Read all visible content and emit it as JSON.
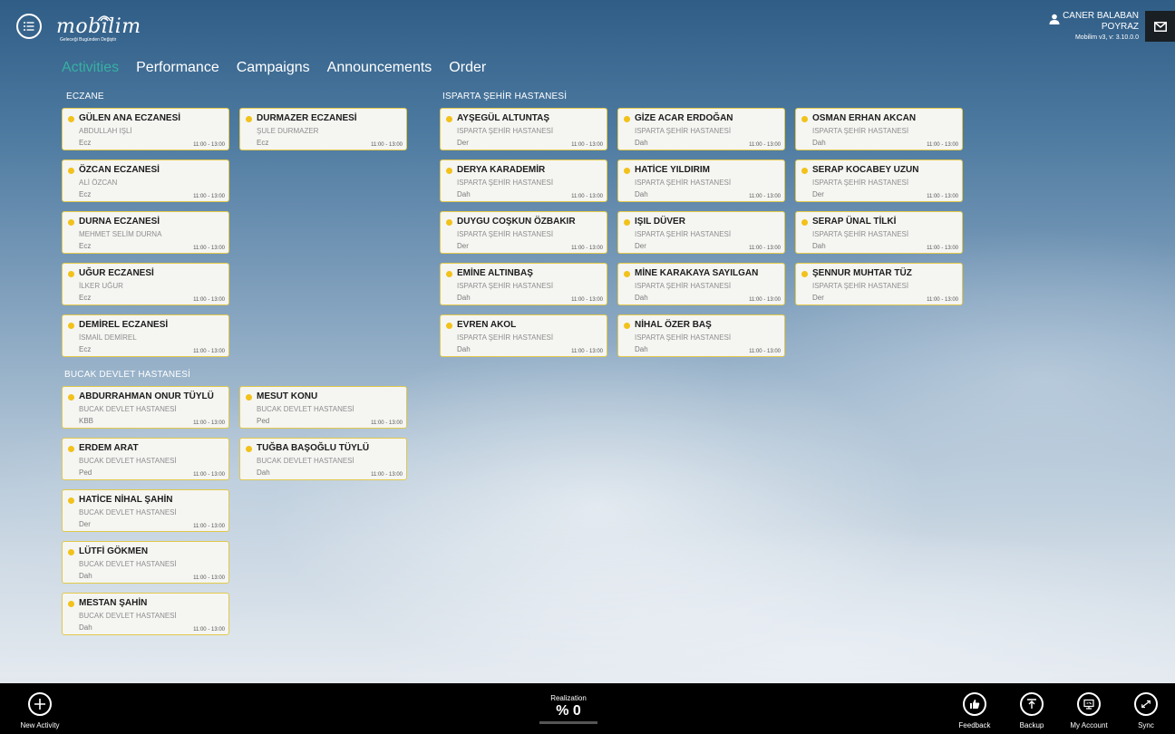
{
  "app": {
    "logo": "mobilim",
    "logo_tagline": "Geleceği Bugünden Değiştir",
    "menu_icon": "hamburger-menu-icon"
  },
  "user": {
    "name": "CANER BALABAN",
    "company": "POYRAZ",
    "version": "Mobilim v3, v: 3.10.0.0",
    "icon": "user-icon"
  },
  "nav": {
    "tabs": [
      {
        "label": "Activities",
        "active": true
      },
      {
        "label": "Performance",
        "active": false
      },
      {
        "label": "Campaigns",
        "active": false
      },
      {
        "label": "Announcements",
        "active": false
      },
      {
        "label": "Order",
        "active": false
      }
    ]
  },
  "groups": {
    "eczane": {
      "title": "ECZANE",
      "cards": [
        {
          "name": "GÜLEN ANA ECZANESİ",
          "sub": "ABDULLAH IŞLİ",
          "spec": "Ecz",
          "time": "11:00 - 13:00"
        },
        {
          "name": "DURMAZER ECZANESİ",
          "sub": "ŞULE DURMAZER",
          "spec": "Ecz",
          "time": "11:00 - 13:00"
        },
        {
          "name": "ÖZCAN ECZANESİ",
          "sub": "ALİ ÖZCAN",
          "spec": "Ecz",
          "time": "11:00 - 13:00"
        },
        {
          "name": "DURNA ECZANESİ",
          "sub": "MEHMET SELİM DURNA",
          "spec": "Ecz",
          "time": "11:00 - 13:00"
        },
        {
          "name": "UĞUR ECZANESİ",
          "sub": "İLKER UĞUR",
          "spec": "Ecz",
          "time": "11:00 - 13:00"
        },
        {
          "name": "DEMİREL ECZANESİ",
          "sub": "İSMAİL DEMİREL",
          "spec": "Ecz",
          "time": "11:00 - 13:00"
        }
      ]
    },
    "bucak": {
      "title": "BUCAK DEVLET HASTANESİ",
      "cards": [
        {
          "name": "ABDURRAHMAN ONUR TÜYLÜ",
          "sub": "BUCAK DEVLET HASTANESİ",
          "spec": "KBB",
          "time": "11:00 - 13:00"
        },
        {
          "name": "MESUT KONU",
          "sub": "BUCAK DEVLET HASTANESİ",
          "spec": "Ped",
          "time": "11:00 - 13:00"
        },
        {
          "name": "ERDEM ARAT",
          "sub": "BUCAK DEVLET HASTANESİ",
          "spec": "Ped",
          "time": "11:00 - 13:00"
        },
        {
          "name": "TUĞBA BAŞOĞLU TÜYLÜ",
          "sub": "BUCAK DEVLET HASTANESİ",
          "spec": "Dah",
          "time": "11:00 - 13:00"
        },
        {
          "name": "HATİCE NİHAL ŞAHİN",
          "sub": "BUCAK DEVLET HASTANESİ",
          "spec": "Der",
          "time": "11:00 - 13:00"
        },
        {
          "name": "LÜTFİ GÖKMEN",
          "sub": "BUCAK DEVLET HASTANESİ",
          "spec": "Dah",
          "time": "11:00 - 13:00"
        },
        {
          "name": "MESTAN ŞAHİN",
          "sub": "BUCAK DEVLET HASTANESİ",
          "spec": "Dah",
          "time": "11:00 - 13:00"
        }
      ]
    },
    "isparta": {
      "title": "ISPARTA ŞEHİR HASTANESİ",
      "cards": [
        {
          "name": "AYŞEGÜL ALTUNTAŞ",
          "sub": "ISPARTA ŞEHİR HASTANESİ",
          "spec": "Der",
          "time": "11:00 - 13:00"
        },
        {
          "name": "GİZE ACAR ERDOĞAN",
          "sub": "ISPARTA ŞEHİR HASTANESİ",
          "spec": "Dah",
          "time": "11:00 - 13:00"
        },
        {
          "name": "OSMAN ERHAN AKCAN",
          "sub": "ISPARTA ŞEHİR HASTANESİ",
          "spec": "Dah",
          "time": "11:00 - 13:00"
        },
        {
          "name": "DERYA KARADEMİR",
          "sub": "ISPARTA ŞEHİR HASTANESİ",
          "spec": "Dah",
          "time": "11:00 - 13:00"
        },
        {
          "name": "HATİCE YILDIRIM",
          "sub": "ISPARTA ŞEHİR HASTANESİ",
          "spec": "Dah",
          "time": "11:00 - 13:00"
        },
        {
          "name": "SERAP KOCABEY UZUN",
          "sub": "ISPARTA ŞEHİR HASTANESİ",
          "spec": "Der",
          "time": "11:00 - 13:00"
        },
        {
          "name": "DUYGU COŞKUN ÖZBAKIR",
          "sub": "ISPARTA ŞEHİR HASTANESİ",
          "spec": "Der",
          "time": "11:00 - 13:00"
        },
        {
          "name": "IŞIL DÜVER",
          "sub": "ISPARTA ŞEHİR HASTANESİ",
          "spec": "Der",
          "time": "11:00 - 13:00"
        },
        {
          "name": "SERAP ÜNAL TİLKİ",
          "sub": "ISPARTA ŞEHİR HASTANESİ",
          "spec": "Dah",
          "time": "11:00 - 13:00"
        },
        {
          "name": "EMİNE ALTINBAŞ",
          "sub": "ISPARTA ŞEHİR HASTANESİ",
          "spec": "Dah",
          "time": "11:00 - 13:00"
        },
        {
          "name": "MİNE KARAKAYA SAYILGAN",
          "sub": "ISPARTA ŞEHİR HASTANESİ",
          "spec": "Dah",
          "time": "11:00 - 13:00"
        },
        {
          "name": "ŞENNUR MUHTAR TÜZ",
          "sub": "ISPARTA ŞEHİR HASTANESİ",
          "spec": "Der",
          "time": "11:00 - 13:00"
        },
        {
          "name": "EVREN AKOL",
          "sub": "ISPARTA ŞEHİR HASTANESİ",
          "spec": "Dah",
          "time": "11:00 - 13:00"
        },
        {
          "name": "NİHAL ÖZER BAŞ",
          "sub": "ISPARTA ŞEHİR HASTANESİ",
          "spec": "Dah",
          "time": "11:00 - 13:00"
        }
      ]
    }
  },
  "bottom_bar": {
    "new_activity": "New Activity",
    "realization_label": "Realization",
    "realization_value": "% 0",
    "feedback": "Feedback",
    "backup": "Backup",
    "my_account": "My Account",
    "sync": "Sync"
  },
  "colors": {
    "accent": "#37b0a2",
    "card_border": "#e2c94a",
    "status_dot": "#f2c21a",
    "bottom_bar": "#000000"
  }
}
